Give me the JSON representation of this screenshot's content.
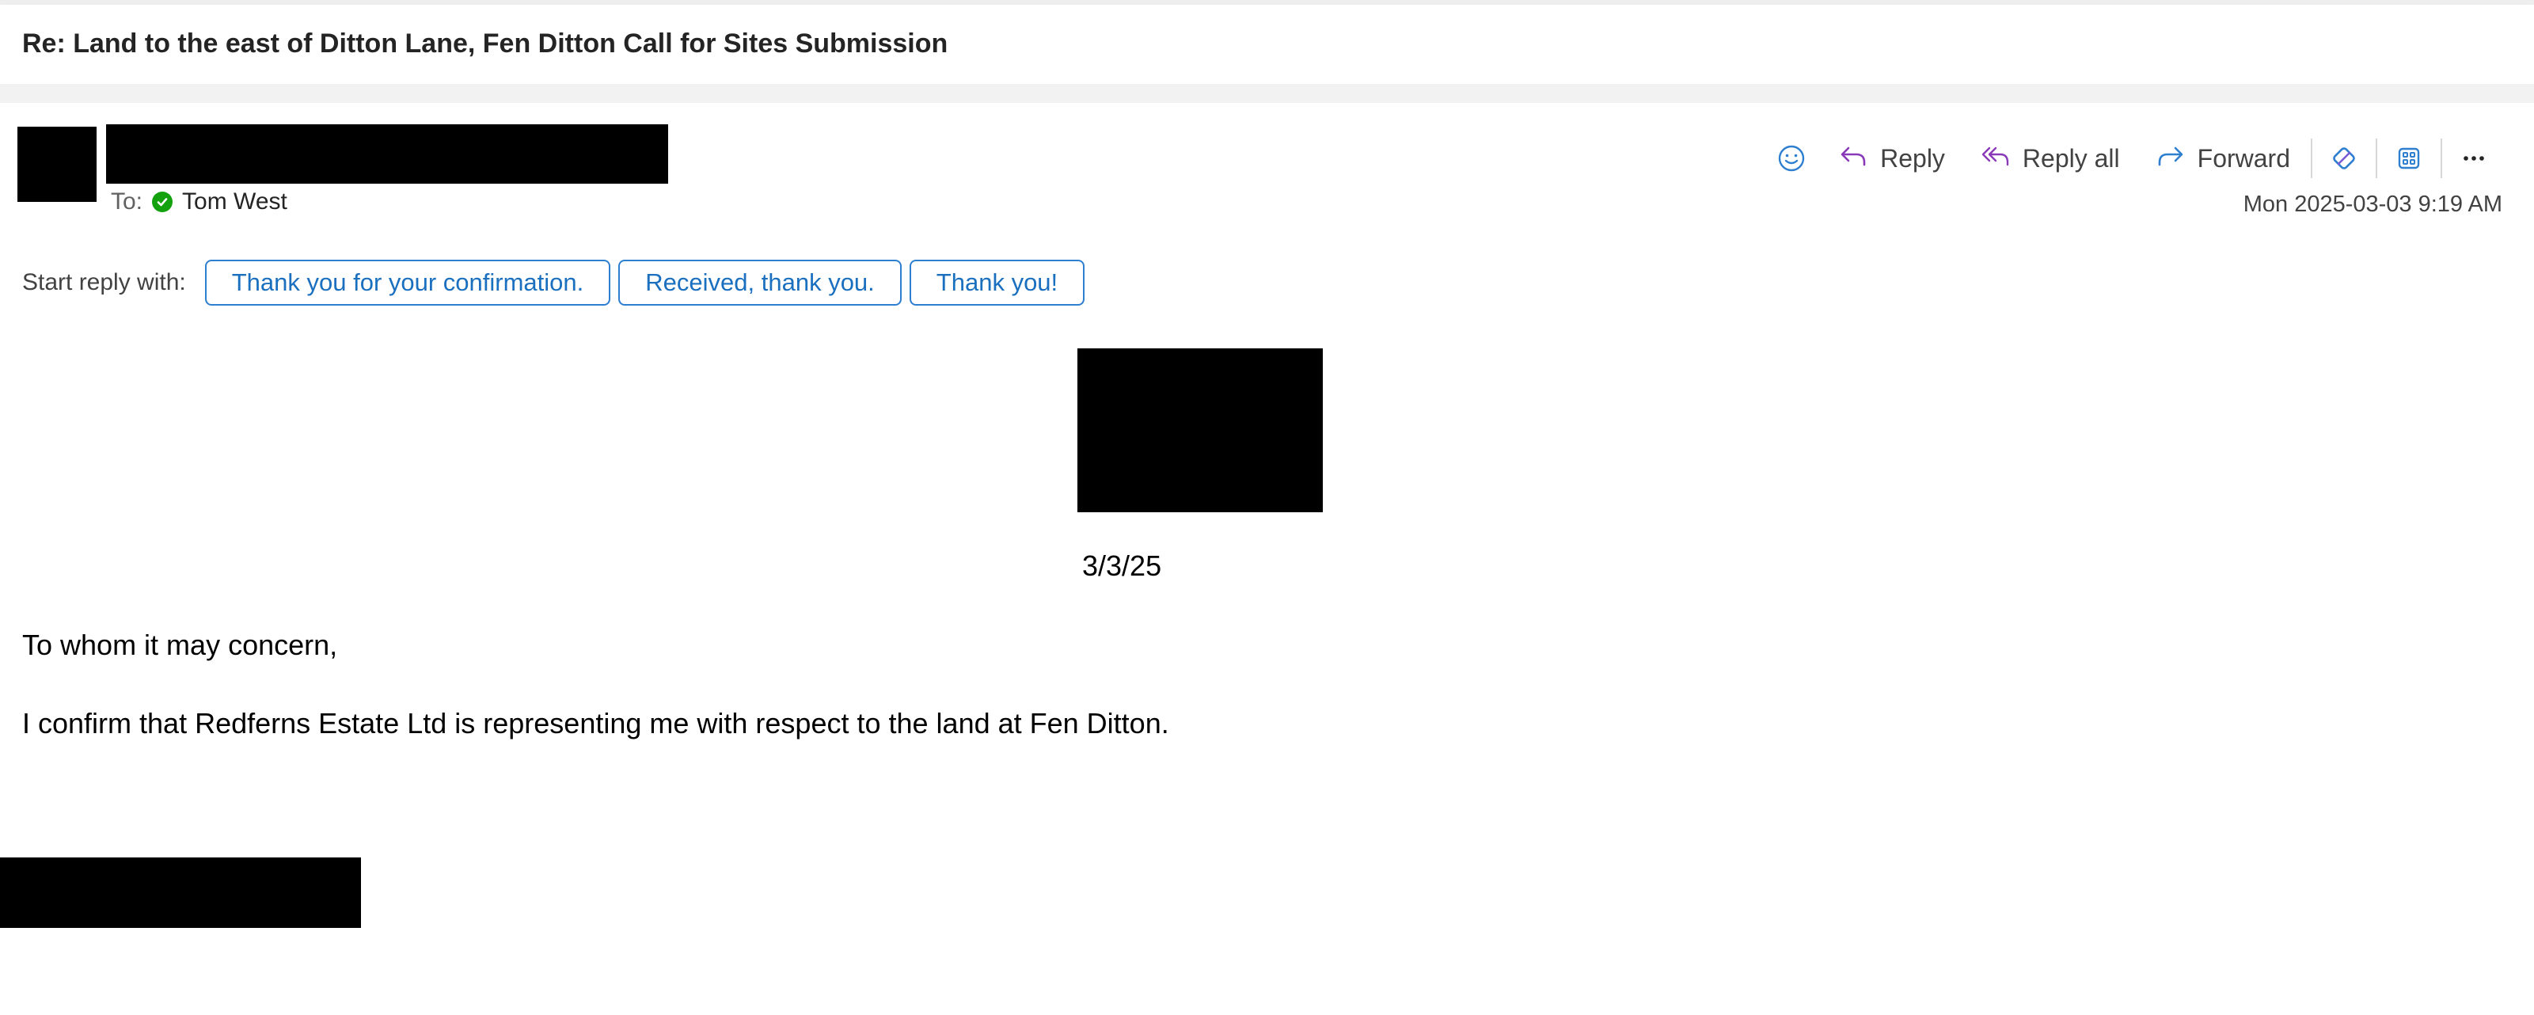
{
  "message": {
    "subject": "Re: Land to the east of Ditton Lane, Fen Ditton Call for Sites Submission",
    "to_label": "To:",
    "recipient": "Tom West",
    "timestamp": "Mon 2025-03-03 9:19 AM"
  },
  "toolbar": {
    "reply_label": "Reply",
    "reply_all_label": "Reply all",
    "forward_label": "Forward",
    "icons": [
      "smiley-icon",
      "reply-icon",
      "reply-all-icon",
      "forward-icon",
      "loop-icon",
      "apps-icon",
      "more-icon"
    ]
  },
  "suggestions": {
    "label": "Start reply with:",
    "items": [
      "Thank you for your confirmation.",
      "Received, thank you.",
      "Thank you!"
    ]
  },
  "body": {
    "date": "3/3/25",
    "greeting": "To whom it may concern,",
    "text": "I confirm that Redferns Estate Ltd is representing me with respect to the land at Fen Ditton."
  },
  "colors": {
    "accent_blue": "#2e7fd0",
    "reply_purple": "#8a3ab9",
    "presence_green": "#13a10e",
    "redaction": "#000000"
  }
}
